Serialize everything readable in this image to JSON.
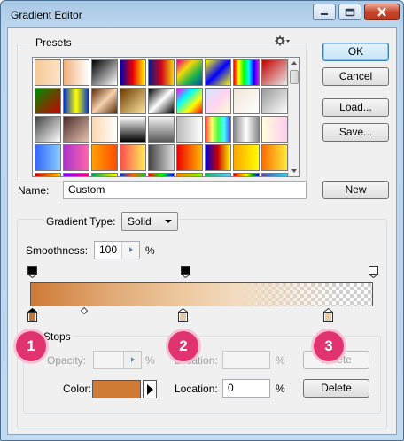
{
  "window": {
    "title": "Gradient Editor"
  },
  "presets": {
    "label": "Presets",
    "swatches": [
      "linear-gradient(90deg,#f6c99a,#fde3c4)",
      "linear-gradient(90deg,#f2b07a,rgba(255,255,255,0))",
      "linear-gradient(135deg,#000,#fff)",
      "linear-gradient(90deg,#00a,#e00,#ff0)",
      "linear-gradient(90deg,#0a1a8a,#d0021b,#f5d90a)",
      "linear-gradient(135deg,#e6007e,#f5d90a,#1bb14c,#0055a5)",
      "linear-gradient(135deg,#ff0,#00f,#ff0)",
      "linear-gradient(90deg,#f00,#ff0,#0f0,#0ff,#00f,#f0f)",
      "linear-gradient(135deg,#c40000,#e8e8e8)",
      "linear-gradient(135deg,#008c00,#cc0000)",
      "linear-gradient(90deg,#0033cc,#ff0,#0033cc)",
      "linear-gradient(135deg,#5a2a0a,#f7d2b0,#5a2a0a)",
      "linear-gradient(135deg,#6a3a00,#ffe7a0)",
      "linear-gradient(135deg,#000,#fff 50%,#000)",
      "linear-gradient(135deg,#f0f,#0ff,#ff0,#f00)",
      "linear-gradient(135deg,#d4e8ff,#ffd4f0,#fffcd4)",
      "linear-gradient(135deg,#f0e6d8,#fff)",
      "linear-gradient(135deg,#999,#fff)",
      "linear-gradient(135deg,#444,#fff)",
      "linear-gradient(135deg,#4a2c2a,#e8c3b0)",
      "linear-gradient(90deg,#fcd8b0,#fff)",
      "linear-gradient(180deg,#fff,#000)",
      "linear-gradient(180deg,#f2f2f2,#5a5a5a)",
      "linear-gradient(90deg,#bbb,#fff)",
      "linear-gradient(90deg,#f44,#ff6,#4f4,#4ff,#44f)",
      "linear-gradient(90deg,#888,#fff,#888)",
      "linear-gradient(90deg,#ffd,#fce)",
      "linear-gradient(90deg,#36f,#8cf)",
      "linear-gradient(90deg,#a3c,#f6a)",
      "linear-gradient(90deg,#ff9f00,#ff4d00)",
      "linear-gradient(90deg,#ff4d4d,#ffef5a)",
      "linear-gradient(90deg,#444,#ddd)",
      "linear-gradient(90deg,#e00,#fb0)",
      "linear-gradient(90deg,#00c,#c00,#ff0)",
      "linear-gradient(90deg,#ffa500,#ff0)",
      "linear-gradient(90deg,#ff6f00,#ffeb3b)",
      "linear-gradient(90deg,#c40000,#ffcc00)",
      "linear-gradient(90deg,#7f00ff,#ff007f)",
      "linear-gradient(90deg,#009e60,#ff0)",
      "linear-gradient(90deg,#03c,#f60,#0c3)",
      "linear-gradient(90deg,#f00,#0f0,#00f)",
      "linear-gradient(90deg,#ff8000,#80ff00)",
      "linear-gradient(90deg,#2a6,#6cf)",
      "linear-gradient(90deg,#c00,#f80,#ff0,#0a0,#00f)",
      "linear-gradient(90deg,#5a4ba0,#2dd8e8)"
    ]
  },
  "buttons": {
    "ok": "OK",
    "cancel": "Cancel",
    "load": "Load...",
    "save": "Save...",
    "new": "New",
    "delete": "Delete"
  },
  "name": {
    "label": "Name:",
    "value": "Custom"
  },
  "gradient": {
    "type_label": "Gradient Type:",
    "type_value": "Solid",
    "smoothness_label": "Smoothness:",
    "smoothness_value": "100",
    "smoothness_unit": "%",
    "fill": "linear-gradient(90deg,#cf7a35 0%,#e0a773 22%,#eec9a0 45%,#f2dcc0 60%,rgba(240,218,190,0.6) 72%,rgba(255,255,255,0) 92%)"
  },
  "stops": {
    "label": "Stops",
    "opacity_label": "Opacity:",
    "opacity_value": "",
    "opacity_unit": "%",
    "opacity_location_label": "Location:",
    "opacity_location_value": "",
    "opacity_location_unit": "%",
    "color_label": "Color:",
    "color_value": "#cf7a35",
    "color_location_label": "Location:",
    "color_location_value": "0",
    "color_location_unit": "%",
    "color_stops": [
      "#c2773d",
      "#e6c9a8",
      "#e8ccaa"
    ]
  },
  "badges": [
    "1",
    "2",
    "3"
  ],
  "colors": {
    "accent": "#e0336f",
    "title_bar": "#bcd6ee"
  }
}
